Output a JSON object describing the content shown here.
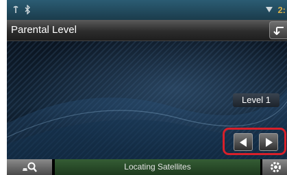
{
  "status_bar": {
    "left_icons": [
      "signal-icon",
      "bluetooth-icon"
    ],
    "right_icons": [
      "wifi-icon"
    ],
    "clock_partial": "2:"
  },
  "header": {
    "title": "Parental Level",
    "back_icon": "back-arrow-icon"
  },
  "main": {
    "level_label": "Level 1",
    "prev_icon": "left-triangle-icon",
    "next_icon": "right-triangle-icon",
    "highlight_color": "#d8202a"
  },
  "bottom_bar": {
    "search_icon": "map-search-icon",
    "nav_status": "Locating Satellites",
    "nav_status_color": "#2f5a2f",
    "settings_icon": "gear-icon"
  }
}
